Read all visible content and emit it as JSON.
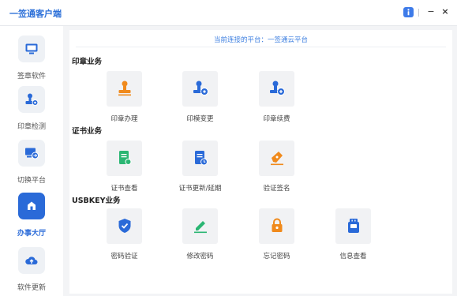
{
  "app": {
    "title": "一签通客户端"
  },
  "window": {
    "minimize": "−",
    "close": "×"
  },
  "sidebar": {
    "items": [
      {
        "label": "签章软件",
        "icon": "monitor-icon"
      },
      {
        "label": "印章检测",
        "icon": "seal-check-icon"
      },
      {
        "label": "切换平台",
        "icon": "switch-platform-icon"
      },
      {
        "label": "办事大厅",
        "icon": "home-icon",
        "active": true
      },
      {
        "label": "软件更新",
        "icon": "cloud-upload-icon"
      }
    ]
  },
  "main": {
    "connection": "当前连接的平台：一签通云平台",
    "sections": [
      {
        "title": "印章业务",
        "items": [
          {
            "label": "印章办理",
            "icon": "seal-stamp-icon",
            "color": "#f08a1c"
          },
          {
            "label": "印模变更",
            "icon": "seal-change-icon",
            "color": "#2a6ad8"
          },
          {
            "label": "印章续费",
            "icon": "seal-renew-icon",
            "color": "#2a6ad8"
          }
        ]
      },
      {
        "title": "证书业务",
        "items": [
          {
            "label": "证书查看",
            "icon": "certificate-view-icon",
            "color": "#2bb673"
          },
          {
            "label": "证书更新/延期",
            "icon": "certificate-update-icon",
            "color": "#2a6ad8"
          },
          {
            "label": "验证签名",
            "icon": "verify-signature-icon",
            "color": "#f08a1c"
          }
        ]
      },
      {
        "title": "USBKEY业务",
        "items": [
          {
            "label": "密码验证",
            "icon": "shield-check-icon",
            "color": "#2a6ad8"
          },
          {
            "label": "修改密码",
            "icon": "edit-pen-icon",
            "color": "#2bb673"
          },
          {
            "label": "忘记密码",
            "icon": "lock-icon",
            "color": "#f08a1c"
          },
          {
            "label": "信息查看",
            "icon": "usb-key-icon",
            "color": "#2a6ad8"
          }
        ]
      }
    ]
  }
}
